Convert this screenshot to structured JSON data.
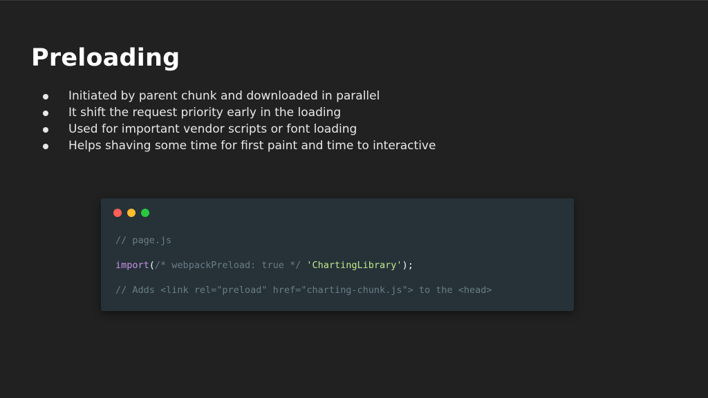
{
  "slide": {
    "title": "Preloading",
    "bullets": [
      "Initiated by parent chunk and downloaded in parallel",
      "It shift the request priority early in the loading",
      "Used for important vendor scripts or font loading",
      "Helps shaving some time for first paint and time to interactive"
    ]
  },
  "code": {
    "line1_comment": "// page.js",
    "line2_keyword": "import",
    "line2_open": "(",
    "line2_comment": "/* webpackPreload: true */",
    "line2_space": " ",
    "line2_string": "'ChartingLibrary'",
    "line2_close": ");",
    "line3_comment": "// Adds <link rel=\"preload\" href=\"charting-chunk.js\"> to the <head>"
  },
  "colors": {
    "background": "#212121",
    "code_background": "#263238",
    "traffic_red": "#ff5f56",
    "traffic_yellow": "#ffbd2e",
    "traffic_green": "#27c93f",
    "keyword": "#c792ea",
    "string": "#c3e88d",
    "comment": "#6b7d86"
  },
  "icons": {
    "window_controls": [
      "close-dot-icon",
      "minimize-dot-icon",
      "maximize-dot-icon"
    ],
    "bullet": "bullet-dot-icon"
  }
}
